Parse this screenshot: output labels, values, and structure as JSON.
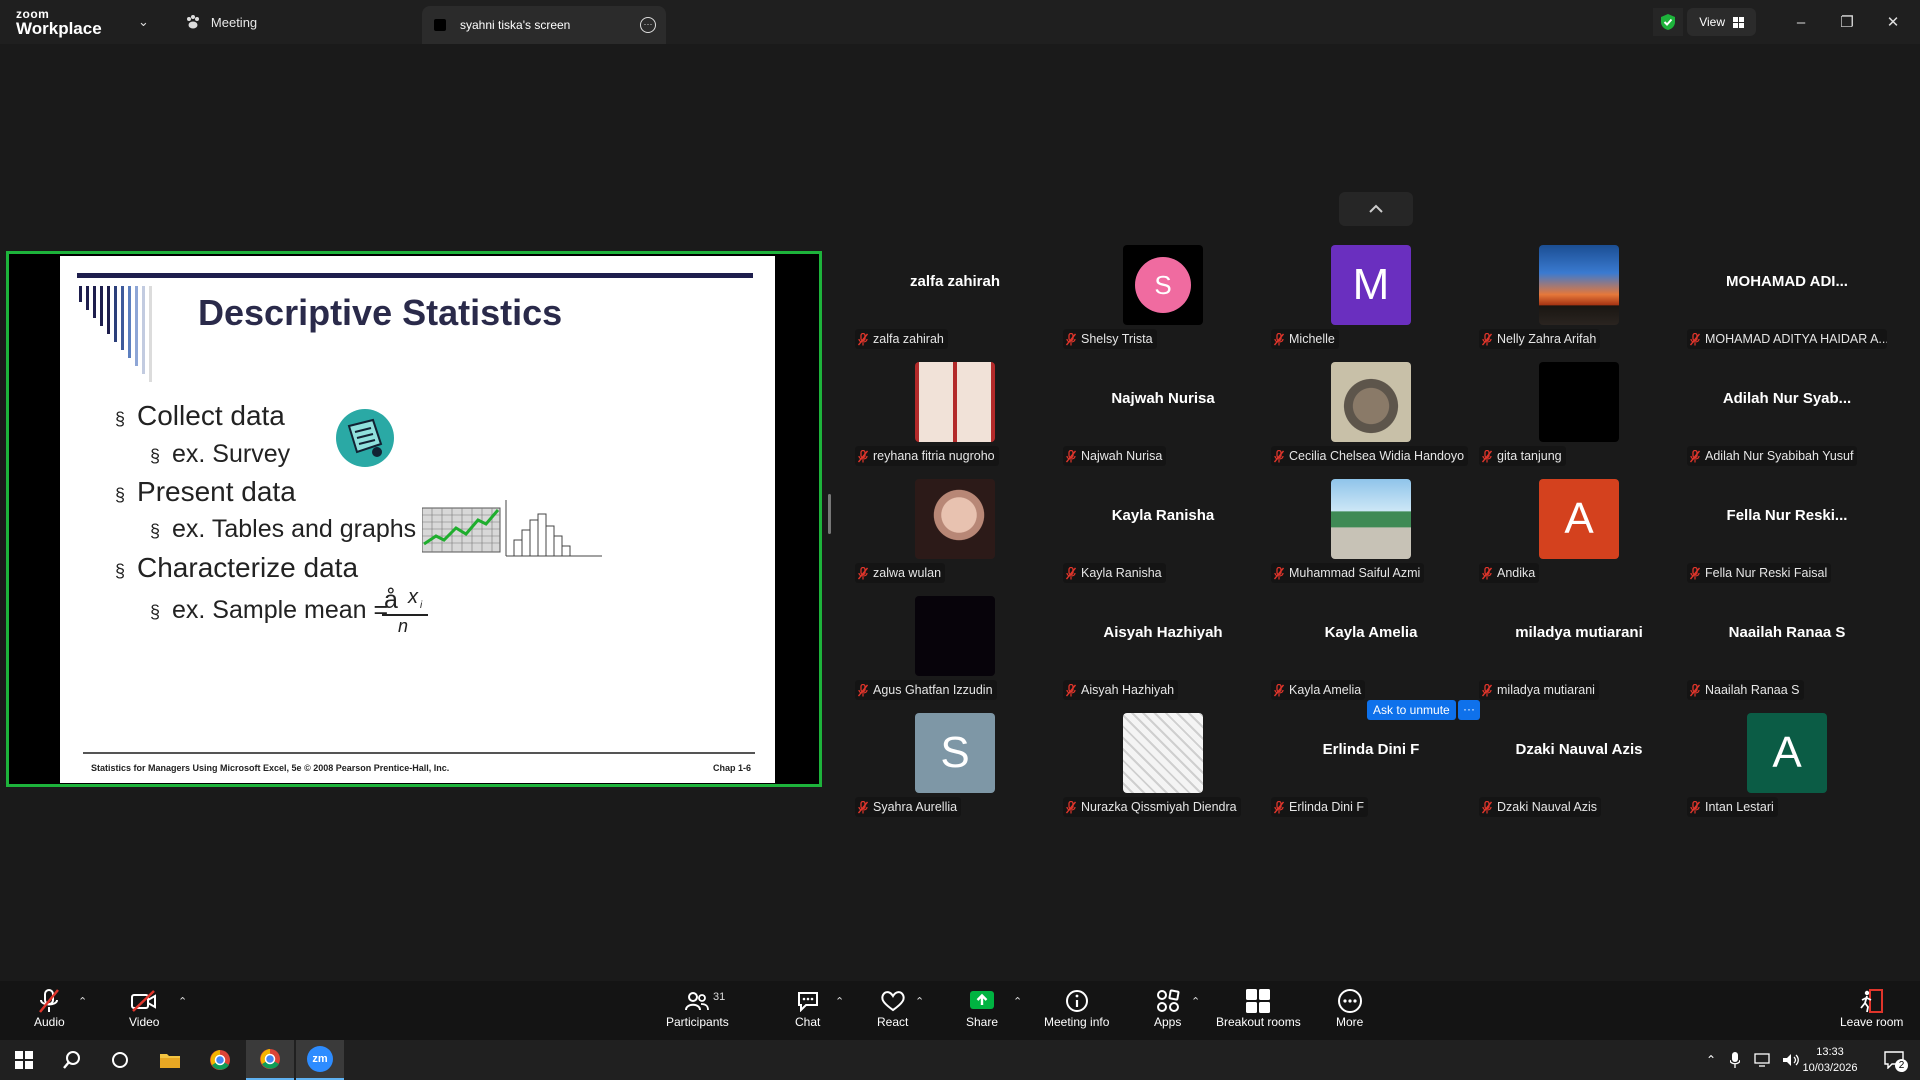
{
  "titlebar": {
    "brand_top": "zoom",
    "brand_bottom": "Workplace",
    "meeting_tab": "Meeting",
    "screen_tab": "syahni tiska's screen",
    "view_label": "View"
  },
  "slide": {
    "title": "Descriptive Statistics",
    "bullets": [
      "Collect data",
      "Present data",
      "Characterize data"
    ],
    "subs": [
      "ex. Survey",
      "ex. Tables and graphs",
      "ex. Sample mean ="
    ],
    "bullet_mark": "§",
    "formula_sum": "å",
    "formula_x": "x",
    "formula_i": "i",
    "formula_n": "n",
    "footer_left": "Statistics for Managers Using Microsoft Excel, 5e © 2008 Pearson Prentice-Hall, Inc.",
    "footer_right": "Chap 1-6"
  },
  "participants": [
    {
      "name": "zalfa zahirah",
      "big": "zalfa zahirah",
      "avatar": "none"
    },
    {
      "name": "Shelsy Trista",
      "avatar": "S",
      "color": "#000000",
      "circle": "#f06ba0"
    },
    {
      "name": "Michelle",
      "avatar": "M",
      "color": "#6a2fbf"
    },
    {
      "name": "Nelly Zahra Arifah",
      "avatar": "photo-sunset"
    },
    {
      "name": "MOHAMAD ADITYA HAIDAR A...",
      "big": "MOHAMAD  ADI...",
      "avatar": "none"
    },
    {
      "name": "reyhana fitria nugroho",
      "avatar": "photo-collage"
    },
    {
      "name": "Najwah Nurisa",
      "big": "Najwah Nurisa",
      "avatar": "none"
    },
    {
      "name": "Cecilia Chelsea Widia Handoyo",
      "avatar": "photo-cat"
    },
    {
      "name": "gita tanjung",
      "avatar": "photo-black"
    },
    {
      "name": "Adilah Nur Syabibah Yusuf",
      "big": "Adilah  Nur  Syab...",
      "avatar": "none"
    },
    {
      "name": "zalwa wulan",
      "avatar": "photo-face"
    },
    {
      "name": "Kayla Ranisha",
      "big": "Kayla Ranisha",
      "avatar": "none"
    },
    {
      "name": "Muhammad Saiful Azmi",
      "avatar": "photo-beach"
    },
    {
      "name": "Andika",
      "avatar": "A",
      "color": "#d4411e"
    },
    {
      "name": "Fella Nur Reski Faisal",
      "big": "Fella  Nur  Reski...",
      "avatar": "none"
    },
    {
      "name": "Agus Ghatfan Izzudin",
      "avatar": "photo-dark"
    },
    {
      "name": "Aisyah Hazhiyah",
      "big": "Aisyah Hazhiyah",
      "avatar": "none"
    },
    {
      "name": "Kayla Amelia",
      "big": "Kayla Amelia",
      "avatar": "none"
    },
    {
      "name": "miladya mutiarani",
      "big": "miladya mutiarani",
      "avatar": "none"
    },
    {
      "name": "Naailah Ranaa S",
      "big": "Naailah Ranaa S",
      "avatar": "none"
    },
    {
      "name": "Syahra Aurellia",
      "avatar": "S",
      "color": "#7e97a6"
    },
    {
      "name": "Nurazka Qissmiyah Diendra",
      "avatar": "photo-manga"
    },
    {
      "name": "Erlinda Dini F",
      "big": "Erlinda Dini F",
      "avatar": "none"
    },
    {
      "name": "Dzaki Nauval Azis",
      "big": "Dzaki Nauval Azis",
      "avatar": "none"
    },
    {
      "name": "Intan Lestari",
      "avatar": "A",
      "color": "#0b5c45"
    }
  ],
  "ask_to_unmute": "Ask to unmute",
  "ask_more": "···",
  "toolbar": {
    "audio": "Audio",
    "video": "Video",
    "participants": "Participants",
    "participants_count": "31",
    "chat": "Chat",
    "react": "React",
    "share": "Share",
    "meeting_info": "Meeting info",
    "apps": "Apps",
    "breakout": "Breakout rooms",
    "more": "More",
    "leave": "Leave room"
  },
  "taskbar": {
    "time": "13:33",
    "date": "10/03/2026",
    "notifications": "2",
    "zoom_label": "zm"
  },
  "colors": {
    "share_border": "#1db33b",
    "accent_blue": "#0e71eb",
    "muted_red": "#e0352b",
    "share_green": "#00b341"
  }
}
